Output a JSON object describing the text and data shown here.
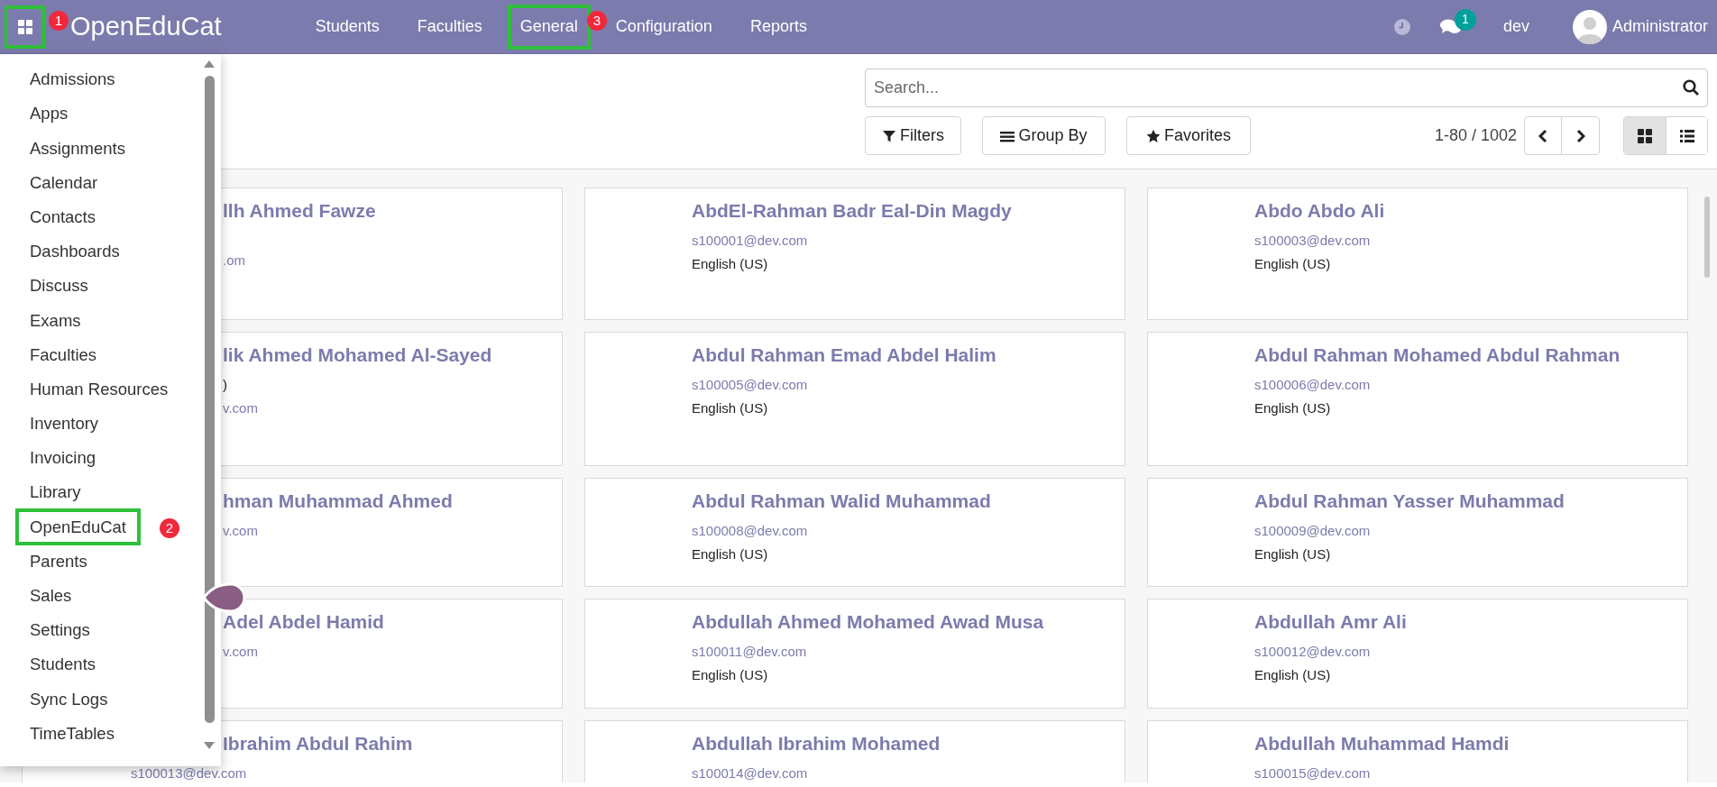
{
  "navbar": {
    "app_button": {
      "highlighted": true
    },
    "brand": "OpenEduCat",
    "menu": [
      {
        "label": "Students",
        "highlighted": false
      },
      {
        "label": "Faculties",
        "highlighted": false
      },
      {
        "label": "General",
        "highlighted": true
      },
      {
        "label": "Configuration",
        "highlighted": false
      },
      {
        "label": "Reports",
        "highlighted": false
      }
    ],
    "chat_badge": "1",
    "database": "dev",
    "user": "Administrator"
  },
  "app_menu": {
    "items": [
      {
        "label": "Admissions",
        "highlighted": false
      },
      {
        "label": "Apps",
        "highlighted": false
      },
      {
        "label": "Assignments",
        "highlighted": false
      },
      {
        "label": "Calendar",
        "highlighted": false
      },
      {
        "label": "Contacts",
        "highlighted": false
      },
      {
        "label": "Dashboards",
        "highlighted": false
      },
      {
        "label": "Discuss",
        "highlighted": false
      },
      {
        "label": "Exams",
        "highlighted": false
      },
      {
        "label": "Faculties",
        "highlighted": false
      },
      {
        "label": "Human Resources",
        "highlighted": false
      },
      {
        "label": "Inventory",
        "highlighted": false
      },
      {
        "label": "Invoicing",
        "highlighted": false
      },
      {
        "label": "Library",
        "highlighted": false
      },
      {
        "label": "OpenEduCat",
        "highlighted": true
      },
      {
        "label": "Parents",
        "highlighted": false
      },
      {
        "label": "Sales",
        "highlighted": false
      },
      {
        "label": "Settings",
        "highlighted": false
      },
      {
        "label": "Students",
        "highlighted": false
      },
      {
        "label": "Sync Logs",
        "highlighted": false
      },
      {
        "label": "TimeTables",
        "highlighted": false
      }
    ]
  },
  "annotations": [
    {
      "number": "1"
    },
    {
      "number": "2"
    },
    {
      "number": "3"
    }
  ],
  "control_panel": {
    "search": {
      "placeholder": "Search..."
    },
    "buttons": [
      {
        "kind": "filter",
        "label": "Filters"
      },
      {
        "kind": "group",
        "label": "Group By"
      },
      {
        "kind": "favorite",
        "label": "Favorites"
      }
    ],
    "pager": "1-80 / 1002",
    "views": [
      {
        "kind": "kanban",
        "selected": true
      },
      {
        "kind": "list",
        "selected": false
      }
    ]
  },
  "cards": [
    {
      "name": "llh Ahmed Fawze",
      "lines": [
        {
          "kind": "email",
          "text": ".om"
        }
      ]
    },
    {
      "name": "AbdEl-Rahman Badr Eal-Din Magdy",
      "lines": [
        {
          "kind": "email",
          "text": "s100001@dev.com"
        },
        {
          "kind": "language",
          "text": "English (US)"
        }
      ]
    },
    {
      "name": "Abdo Abdo Ali",
      "lines": [
        {
          "kind": "email",
          "text": "s100003@dev.com"
        },
        {
          "kind": "language",
          "text": "English (US)"
        }
      ]
    },
    {
      "name": "lik Ahmed Mohamed Al-Sayed",
      "lines": [
        {
          "kind": "language",
          "text": ")"
        },
        {
          "kind": "email",
          "text": "v.com"
        }
      ]
    },
    {
      "name": "Abdul Rahman Emad Abdel Halim",
      "lines": [
        {
          "kind": "email",
          "text": "s100005@dev.com"
        },
        {
          "kind": "language",
          "text": "English (US)"
        }
      ]
    },
    {
      "name": "Abdul Rahman Mohamed Abdul Rahman",
      "lines": [
        {
          "kind": "email",
          "text": "s100006@dev.com"
        },
        {
          "kind": "language",
          "text": "English (US)"
        }
      ]
    },
    {
      "name": "hman Muhammad Ahmed",
      "lines": [
        {
          "kind": "email",
          "text": "v.com"
        }
      ]
    },
    {
      "name": "Abdul Rahman Walid Muhammad",
      "lines": [
        {
          "kind": "email",
          "text": "s100008@dev.com"
        },
        {
          "kind": "language",
          "text": "English (US)"
        }
      ]
    },
    {
      "name": "Abdul Rahman Yasser Muhammad",
      "lines": [
        {
          "kind": "email",
          "text": "s100009@dev.com"
        },
        {
          "kind": "language",
          "text": "English (US)"
        }
      ]
    },
    {
      "name": "Adel Abdel Hamid",
      "lines": [
        {
          "kind": "email",
          "text": "v.com"
        }
      ]
    },
    {
      "name": "Abdullah Ahmed Mohamed Awad Musa",
      "lines": [
        {
          "kind": "email",
          "text": "s100011@dev.com"
        },
        {
          "kind": "language",
          "text": "English (US)"
        }
      ]
    },
    {
      "name": "Abdullah Amr Ali",
      "lines": [
        {
          "kind": "email",
          "text": "s100012@dev.com"
        },
        {
          "kind": "language",
          "text": "English (US)"
        }
      ]
    },
    {
      "name": "Ibrahim Abdul Rahim",
      "lines": [
        {
          "kind": "email",
          "text": "s100013@dev.com"
        }
      ]
    },
    {
      "name": "Abdullah Ibrahim Mohamed",
      "lines": [
        {
          "kind": "email",
          "text": "s100014@dev.com"
        }
      ]
    },
    {
      "name": "Abdullah Muhammad Hamdi",
      "lines": [
        {
          "kind": "email",
          "text": "s100015@dev.com"
        }
      ]
    }
  ]
}
